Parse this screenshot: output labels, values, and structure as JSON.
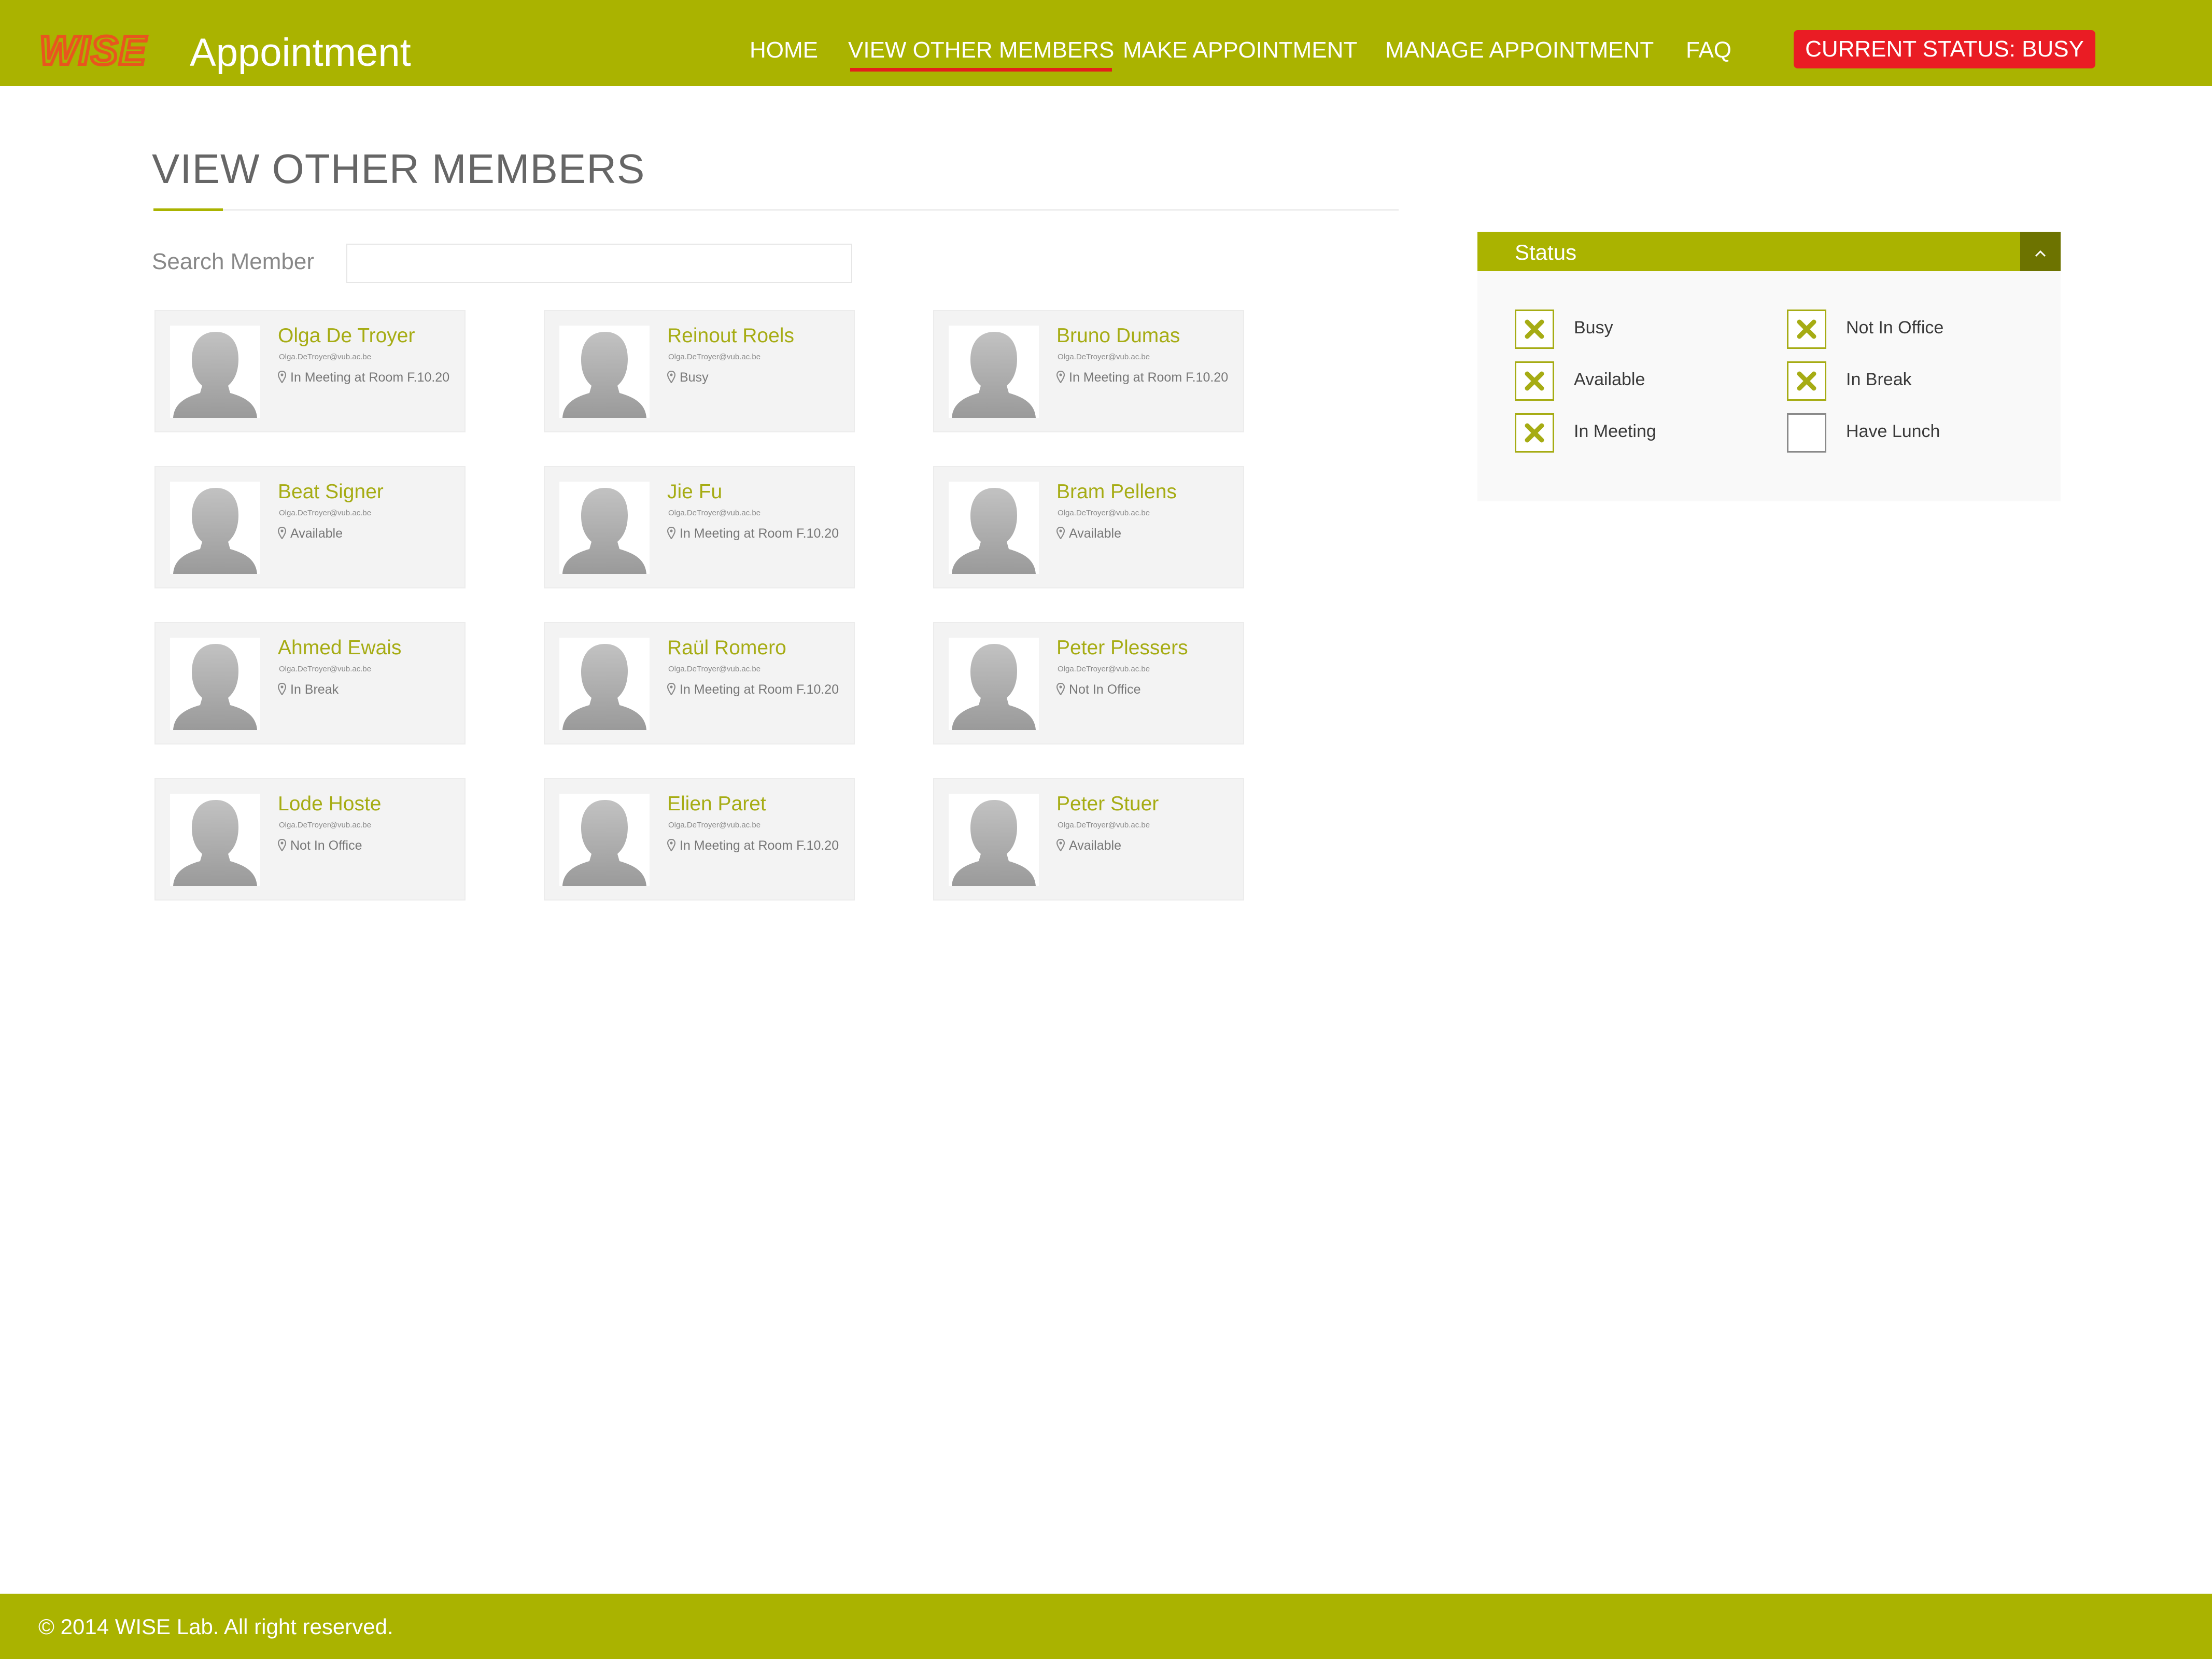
{
  "header": {
    "logo_text": "WISE",
    "app_title": "Appointment",
    "nav": [
      "HOME",
      "VIEW OTHER MEMBERS",
      "MAKE APPOINTMENT",
      "MANAGE APPOINTMENT",
      "FAQ"
    ],
    "active_nav": "VIEW OTHER MEMBERS",
    "status_button": "CURRENT STATUS: BUSY"
  },
  "page": {
    "title": "VIEW OTHER MEMBERS",
    "search_label": "Search Member",
    "search_value": ""
  },
  "members": [
    {
      "name": "Olga De Troyer",
      "email": "Olga.DeTroyer@vub.ac.be",
      "status": "In Meeting at Room F.10.20"
    },
    {
      "name": "Reinout Roels",
      "email": "Olga.DeTroyer@vub.ac.be",
      "status": "Busy"
    },
    {
      "name": "Bruno Dumas",
      "email": "Olga.DeTroyer@vub.ac.be",
      "status": "In Meeting at Room F.10.20"
    },
    {
      "name": "Beat Signer",
      "email": "Olga.DeTroyer@vub.ac.be",
      "status": "Available"
    },
    {
      "name": "Jie Fu",
      "email": "Olga.DeTroyer@vub.ac.be",
      "status": "In Meeting at Room F.10.20"
    },
    {
      "name": "Bram Pellens",
      "email": "Olga.DeTroyer@vub.ac.be",
      "status": "Available"
    },
    {
      "name": "Ahmed Ewais",
      "email": "Olga.DeTroyer@vub.ac.be",
      "status": "In Break"
    },
    {
      "name": "Raül Romero",
      "email": "Olga.DeTroyer@vub.ac.be",
      "status": "In Meeting at Room F.10.20"
    },
    {
      "name": "Peter Plessers",
      "email": "Olga.DeTroyer@vub.ac.be",
      "status": "Not In Office"
    },
    {
      "name": "Lode Hoste",
      "email": "Olga.DeTroyer@vub.ac.be",
      "status": "Not In Office"
    },
    {
      "name": "Elien Paret",
      "email": "Olga.DeTroyer@vub.ac.be",
      "status": "In Meeting at Room F.10.20"
    },
    {
      "name": "Peter Stuer",
      "email": "Olga.DeTroyer@vub.ac.be",
      "status": "Available"
    }
  ],
  "status_panel": {
    "title": "Status",
    "collapse_icon": "chevron-up-icon",
    "filters": [
      {
        "label": "Busy",
        "checked": true
      },
      {
        "label": "Not In Office",
        "checked": true
      },
      {
        "label": "Available",
        "checked": true
      },
      {
        "label": "In Break",
        "checked": true
      },
      {
        "label": "In Meeting",
        "checked": true
      },
      {
        "label": "Have Lunch",
        "checked": false
      }
    ]
  },
  "footer": {
    "text": "© 2014 WISE Lab. All right reserved."
  },
  "colors": {
    "brand": "#aab300",
    "brand_dark": "#6d7300",
    "name_text": "#a6ac14",
    "alert": "#ea1c24",
    "logo_orange": "#e8561e"
  }
}
